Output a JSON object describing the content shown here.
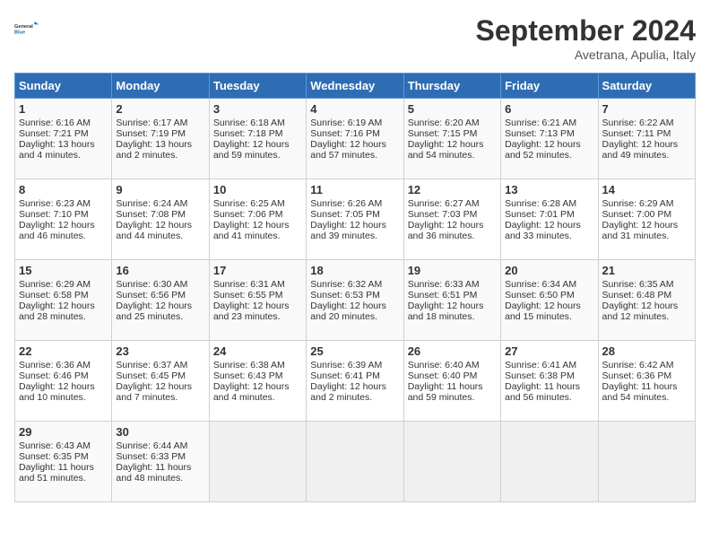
{
  "header": {
    "logo_text_general": "General",
    "logo_text_blue": "Blue",
    "month_title": "September 2024",
    "subtitle": "Avetrana, Apulia, Italy"
  },
  "weekdays": [
    "Sunday",
    "Monday",
    "Tuesday",
    "Wednesday",
    "Thursday",
    "Friday",
    "Saturday"
  ],
  "weeks": [
    [
      {
        "day": "1",
        "lines": [
          "Sunrise: 6:16 AM",
          "Sunset: 7:21 PM",
          "Daylight: 13 hours",
          "and 4 minutes."
        ]
      },
      {
        "day": "2",
        "lines": [
          "Sunrise: 6:17 AM",
          "Sunset: 7:19 PM",
          "Daylight: 13 hours",
          "and 2 minutes."
        ]
      },
      {
        "day": "3",
        "lines": [
          "Sunrise: 6:18 AM",
          "Sunset: 7:18 PM",
          "Daylight: 12 hours",
          "and 59 minutes."
        ]
      },
      {
        "day": "4",
        "lines": [
          "Sunrise: 6:19 AM",
          "Sunset: 7:16 PM",
          "Daylight: 12 hours",
          "and 57 minutes."
        ]
      },
      {
        "day": "5",
        "lines": [
          "Sunrise: 6:20 AM",
          "Sunset: 7:15 PM",
          "Daylight: 12 hours",
          "and 54 minutes."
        ]
      },
      {
        "day": "6",
        "lines": [
          "Sunrise: 6:21 AM",
          "Sunset: 7:13 PM",
          "Daylight: 12 hours",
          "and 52 minutes."
        ]
      },
      {
        "day": "7",
        "lines": [
          "Sunrise: 6:22 AM",
          "Sunset: 7:11 PM",
          "Daylight: 12 hours",
          "and 49 minutes."
        ]
      }
    ],
    [
      {
        "day": "8",
        "lines": [
          "Sunrise: 6:23 AM",
          "Sunset: 7:10 PM",
          "Daylight: 12 hours",
          "and 46 minutes."
        ]
      },
      {
        "day": "9",
        "lines": [
          "Sunrise: 6:24 AM",
          "Sunset: 7:08 PM",
          "Daylight: 12 hours",
          "and 44 minutes."
        ]
      },
      {
        "day": "10",
        "lines": [
          "Sunrise: 6:25 AM",
          "Sunset: 7:06 PM",
          "Daylight: 12 hours",
          "and 41 minutes."
        ]
      },
      {
        "day": "11",
        "lines": [
          "Sunrise: 6:26 AM",
          "Sunset: 7:05 PM",
          "Daylight: 12 hours",
          "and 39 minutes."
        ]
      },
      {
        "day": "12",
        "lines": [
          "Sunrise: 6:27 AM",
          "Sunset: 7:03 PM",
          "Daylight: 12 hours",
          "and 36 minutes."
        ]
      },
      {
        "day": "13",
        "lines": [
          "Sunrise: 6:28 AM",
          "Sunset: 7:01 PM",
          "Daylight: 12 hours",
          "and 33 minutes."
        ]
      },
      {
        "day": "14",
        "lines": [
          "Sunrise: 6:29 AM",
          "Sunset: 7:00 PM",
          "Daylight: 12 hours",
          "and 31 minutes."
        ]
      }
    ],
    [
      {
        "day": "15",
        "lines": [
          "Sunrise: 6:29 AM",
          "Sunset: 6:58 PM",
          "Daylight: 12 hours",
          "and 28 minutes."
        ]
      },
      {
        "day": "16",
        "lines": [
          "Sunrise: 6:30 AM",
          "Sunset: 6:56 PM",
          "Daylight: 12 hours",
          "and 25 minutes."
        ]
      },
      {
        "day": "17",
        "lines": [
          "Sunrise: 6:31 AM",
          "Sunset: 6:55 PM",
          "Daylight: 12 hours",
          "and 23 minutes."
        ]
      },
      {
        "day": "18",
        "lines": [
          "Sunrise: 6:32 AM",
          "Sunset: 6:53 PM",
          "Daylight: 12 hours",
          "and 20 minutes."
        ]
      },
      {
        "day": "19",
        "lines": [
          "Sunrise: 6:33 AM",
          "Sunset: 6:51 PM",
          "Daylight: 12 hours",
          "and 18 minutes."
        ]
      },
      {
        "day": "20",
        "lines": [
          "Sunrise: 6:34 AM",
          "Sunset: 6:50 PM",
          "Daylight: 12 hours",
          "and 15 minutes."
        ]
      },
      {
        "day": "21",
        "lines": [
          "Sunrise: 6:35 AM",
          "Sunset: 6:48 PM",
          "Daylight: 12 hours",
          "and 12 minutes."
        ]
      }
    ],
    [
      {
        "day": "22",
        "lines": [
          "Sunrise: 6:36 AM",
          "Sunset: 6:46 PM",
          "Daylight: 12 hours",
          "and 10 minutes."
        ]
      },
      {
        "day": "23",
        "lines": [
          "Sunrise: 6:37 AM",
          "Sunset: 6:45 PM",
          "Daylight: 12 hours",
          "and 7 minutes."
        ]
      },
      {
        "day": "24",
        "lines": [
          "Sunrise: 6:38 AM",
          "Sunset: 6:43 PM",
          "Daylight: 12 hours",
          "and 4 minutes."
        ]
      },
      {
        "day": "25",
        "lines": [
          "Sunrise: 6:39 AM",
          "Sunset: 6:41 PM",
          "Daylight: 12 hours",
          "and 2 minutes."
        ]
      },
      {
        "day": "26",
        "lines": [
          "Sunrise: 6:40 AM",
          "Sunset: 6:40 PM",
          "Daylight: 11 hours",
          "and 59 minutes."
        ]
      },
      {
        "day": "27",
        "lines": [
          "Sunrise: 6:41 AM",
          "Sunset: 6:38 PM",
          "Daylight: 11 hours",
          "and 56 minutes."
        ]
      },
      {
        "day": "28",
        "lines": [
          "Sunrise: 6:42 AM",
          "Sunset: 6:36 PM",
          "Daylight: 11 hours",
          "and 54 minutes."
        ]
      }
    ],
    [
      {
        "day": "29",
        "lines": [
          "Sunrise: 6:43 AM",
          "Sunset: 6:35 PM",
          "Daylight: 11 hours",
          "and 51 minutes."
        ]
      },
      {
        "day": "30",
        "lines": [
          "Sunrise: 6:44 AM",
          "Sunset: 6:33 PM",
          "Daylight: 11 hours",
          "and 48 minutes."
        ]
      },
      {
        "day": "",
        "lines": []
      },
      {
        "day": "",
        "lines": []
      },
      {
        "day": "",
        "lines": []
      },
      {
        "day": "",
        "lines": []
      },
      {
        "day": "",
        "lines": []
      }
    ]
  ]
}
